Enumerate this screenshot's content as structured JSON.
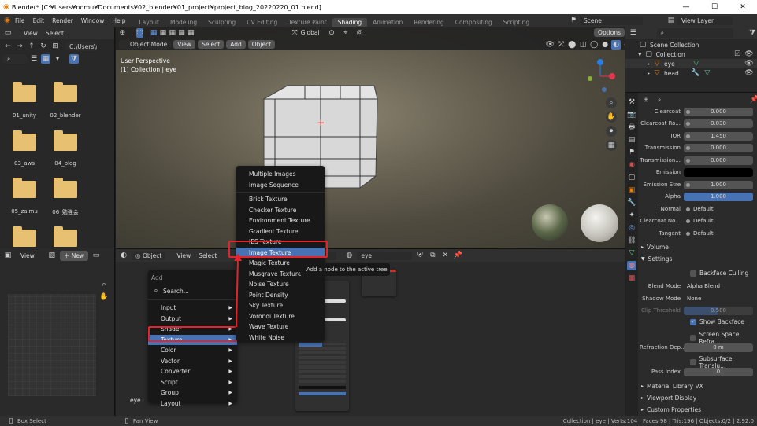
{
  "titlebar": {
    "title": "Blender* [C:¥Users¥nomu¥Documents¥02_blender¥01_project¥project_blog_20220220_01.blend]"
  },
  "topmenu": {
    "items": [
      "File",
      "Edit",
      "Render",
      "Window",
      "Help"
    ]
  },
  "workspaces": [
    "Layout",
    "Modeling",
    "Sculpting",
    "UV Editing",
    "Texture Paint",
    "Shading",
    "Animation",
    "Rendering",
    "Compositing",
    "Scripting"
  ],
  "active_workspace": "Shading",
  "scene": {
    "label": "Scene",
    "view_layer": "View Layer"
  },
  "filebrowser": {
    "menu": [
      "View",
      "Select"
    ],
    "path": "C:\\Users\\n...",
    "folders": [
      "01_unity",
      "02_blender",
      "03_aws",
      "04_blog",
      "05_zaimu",
      "06_勉強会",
      "",
      ""
    ]
  },
  "viewport": {
    "mode": "Object Mode",
    "menu": [
      "View",
      "Select",
      "Add",
      "Object"
    ],
    "orientation": "Global",
    "options": "Options",
    "info_line1": "User Perspective",
    "info_line2": "(1) Collection | eye"
  },
  "node_editor": {
    "object_btn": "Object",
    "menu": [
      "View",
      "Select"
    ],
    "slot": "ot 1",
    "material": "eye",
    "bottom_label": "eye"
  },
  "imgeditor": {
    "menu": [
      "View"
    ],
    "new_btn": "New"
  },
  "add_menu": {
    "title": "Add",
    "search": "Search...",
    "items": [
      "Input",
      "Output",
      "Shader",
      "Texture",
      "Color",
      "Vector",
      "Converter",
      "Script",
      "Group",
      "Layout"
    ],
    "highlight": "Texture"
  },
  "texture_submenu": {
    "items": [
      "Multiple Images",
      "Image Sequence",
      "Brick Texture",
      "Checker Texture",
      "Environment Texture",
      "Gradient Texture",
      "IES Texture",
      "Image Texture",
      "Magic Texture",
      "Musgrave Texture",
      "Noise Texture",
      "Point Density",
      "Sky Texture",
      "Voronoi Texture",
      "Wave Texture",
      "White Noise"
    ],
    "highlight": "Image Texture"
  },
  "tooltip": {
    "text": "Add a node to the active tree."
  },
  "outliner": {
    "title": "Scene Collection",
    "items": [
      "Collection",
      "eye",
      "head"
    ]
  },
  "properties": {
    "rows": [
      {
        "label": "Clearcoat",
        "value": "0.000",
        "style": "dot"
      },
      {
        "label": "Clearcoat Ro...",
        "value": "0.030",
        "style": "dot"
      },
      {
        "label": "IOR",
        "value": "1.450",
        "style": "dot"
      },
      {
        "label": "Transmission",
        "value": "0.000",
        "style": "dot"
      },
      {
        "label": "Transmission...",
        "value": "0.000",
        "style": "dot"
      },
      {
        "label": "Emission",
        "value": "",
        "style": "black"
      },
      {
        "label": "Emission Stre",
        "value": "1.000",
        "style": "dot"
      },
      {
        "label": "Alpha",
        "value": "1.000",
        "style": "blue"
      },
      {
        "label": "Normal",
        "value": "Default",
        "style": "dot"
      },
      {
        "label": "Clearcoat No...",
        "value": "Default",
        "style": "dot"
      },
      {
        "label": "Tangent",
        "value": "Default",
        "style": "dot"
      }
    ],
    "volume": "Volume",
    "settings": "Settings",
    "backface_culling": "Backface Culling",
    "blend_mode_label": "Blend Mode",
    "blend_mode": "Alpha Blend",
    "shadow_mode_label": "Shadow Mode",
    "shadow_mode": "None",
    "clip_threshold_label": "Clip Threshold",
    "clip_threshold": "0.500",
    "show_backface": "Show Backface",
    "screen_space": "Screen Space Refra...",
    "refraction_label": "Refraction Dep...",
    "refraction": "0 m",
    "subsurface": "Subsurface Translu...",
    "pass_index_label": "Pass Index",
    "pass_index": "0",
    "material_library": "Material Library VX",
    "viewport_display": "Viewport Display",
    "custom_properties": "Custom Properties"
  },
  "statusbar": {
    "left1": "Box Select",
    "left2": "Pan View",
    "right": "Collection | eye | Verts:104 | Faces:98 | Tris:196 | Objects:0/2 | 2.92.0"
  },
  "colors": {
    "accent": "#4772b3",
    "highlight_box": "#e3242b",
    "folder": "#e8c071"
  }
}
